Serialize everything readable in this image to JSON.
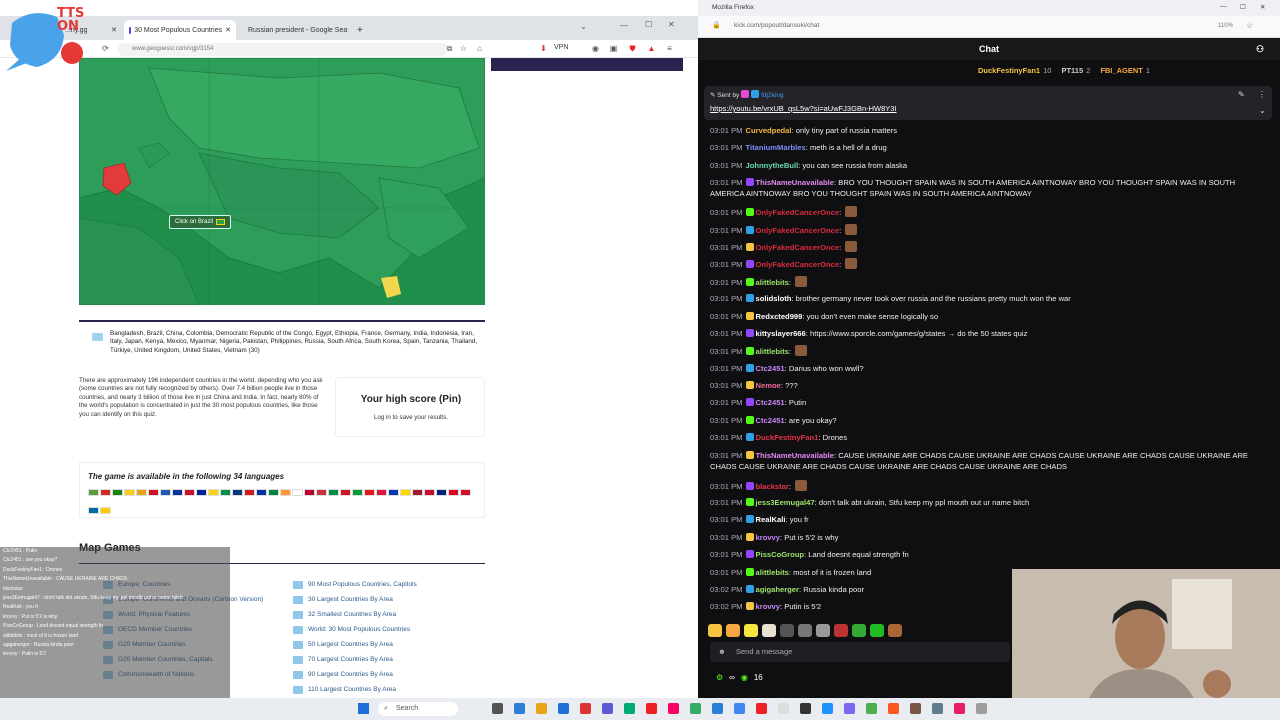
{
  "left_browser": {
    "tabs": [
      {
        "label": "...ny.gg"
      },
      {
        "label": "30 Most Populous Countries"
      },
      {
        "label": "Russian president - Google Sea"
      }
    ],
    "new_tab_symbol": "+",
    "url": "www.geoguessr.com/vgp/3154",
    "vpn_label": "VPN",
    "map_tooltip": "Click on Brazil",
    "answers_text": "Bangladesh, Brazil, China, Colombia, Democratic Republic of the Congo, Egypt, Ethiopia, France, Germany, India, Indonesia, Iran, Italy, Japan, Kenya, Mexico, Myanmar, Nigeria, Pakistan, Philippines, Russia, South Africa, South Korea, Spain, Tanzania, Thailand, Türkiye, United Kingdom, United States, Vietnam (30)",
    "description": "There are approximately 196 independent countries in the world, depending who you ask (some countries are not fully recognized by others). Over 7.4 billion people live in those countries, and nearly 3 billion of those live in just China and India. In fact, nearly 80% of the world's population is concentrated in just the 30 most populous countries, like those you can identify on this quiz.",
    "high_score_title": "Your high score (Pin)",
    "high_score_sub": "Log in to save your results.",
    "languages_title": "The game is available in the following 34 languages",
    "map_games_title": "Map Games",
    "map_games_col1": [
      "Europe: Countries",
      "Europe: Continents and Oceans (Cartoon Version)",
      "World: Physical Features",
      "OECD Member Countries",
      "G20 Member Countries",
      "G20 Member Countries, Capitals",
      "Commonwealth of Nations"
    ],
    "map_games_col2": [
      "90 Most Populous Countries, Capitols",
      "30 Largest Countries By Area",
      "32 Smallest Countries By Area",
      "World: 30 Most Populous Countries",
      "50 Largest Countries By Area",
      "70 Largest Countries By Area",
      "90 Largest Countries By Area",
      "110 Largest Countries By Area"
    ]
  },
  "tts_overlay": {
    "text": "TTS ON"
  },
  "mini_chat": [
    "Ctc2451 : Putin",
    "Ctc2451 : are you okay?",
    "DuckFestinyFan1 : Drones",
    "ThisNameUnavailable : CAUSE UKRAINE ARE CHADS",
    "blackstar",
    "jess3Eemugal47 : don't talk abt ukrain, Stfu keep my ppl mouth out ur name bitch",
    "RealKali : you fr",
    "krovvy : Put is 5'2 is why",
    "PissCoGroup : Land doesnt equal strength fn",
    "alittlebits : most of it is frozen land",
    "agigaherger : Russia kinda poor",
    "krovvy : Putin is 5'2"
  ],
  "right_browser": {
    "window_title": "Mozilla Firefox",
    "url": "kick.com/popout/dansuki/chat",
    "zoom": "110%",
    "chat_title": "Chat",
    "leaderboard": [
      {
        "name": "DuckFestinyFan1",
        "count": "10",
        "color": "#f5c542"
      },
      {
        "name": "PT115",
        "count": "2",
        "color": "#cfcfcf"
      },
      {
        "name": "FBI_AGENT",
        "count": "1",
        "color": "#f5a742"
      }
    ],
    "pinned_by_label": "Sent by",
    "pinned_by_user": "fdj2king",
    "pinned_link": "https://youtu.be/vrxUB_qsL5w?si=aUwFJ3GBn-HW8Y3I",
    "messages": [
      {
        "time": "03:01 PM",
        "user": "Curvedpedal",
        "color": "#f2b640",
        "text": "only tiny part of russia matters"
      },
      {
        "time": "03:01 PM",
        "user": "TitaniumMarbles",
        "color": "#7b8ff7",
        "text": "meth is a hell of a drug"
      },
      {
        "time": "03:01 PM",
        "user": "JohnnytheBull",
        "color": "#6bd9b0",
        "text": "you can see russia from alaska"
      },
      {
        "time": "03:01 PM",
        "user": "ThisNameUnavailable",
        "color": "#e88af5",
        "text": "BRO YOU THOUGHT SPAIN WAS IN SOUTH AMERICA AINTNOWAY BRO YOU THOUGHT SPAIN WAS IN SOUTH AMERICA AINTNOWAY BRO YOU THOUGHT SPAIN WAS IN SOUTH AMERICA AINTNOWAY"
      },
      {
        "time": "03:01 PM",
        "user": "OnlyFakedCancerOnce",
        "color": "#d92c3e",
        "text": ""
      },
      {
        "time": "03:01 PM",
        "user": "OnlyFakedCancerOnce",
        "color": "#d92c3e",
        "text": ""
      },
      {
        "time": "03:01 PM",
        "user": "OnlyFakedCancerOnce",
        "color": "#d92c3e",
        "text": ""
      },
      {
        "time": "03:01 PM",
        "user": "OnlyFakedCancerOnce",
        "color": "#d92c3e",
        "text": ""
      },
      {
        "time": "03:01 PM",
        "user": "alittlebits",
        "color": "#9be36b",
        "text": ""
      },
      {
        "time": "03:01 PM",
        "user": "solidsloth",
        "color": "#ffffff",
        "text": "brother germany never took over russia and the russians pretty much won the war"
      },
      {
        "time": "03:01 PM",
        "user": "Redxcted999",
        "color": "#ffffff",
        "text": "you don't even make sense logically so"
      },
      {
        "time": "03:01 PM",
        "user": "kittyslayer666",
        "color": "#ffffff",
        "text": "https://www.sporcle.com/games/g/states → do the 50 states quiz"
      },
      {
        "time": "03:01 PM",
        "user": "alittlebits",
        "color": "#9be36b",
        "text": ""
      },
      {
        "time": "03:01 PM",
        "user": "Ctc2451",
        "color": "#c58af7",
        "text": "Darius who won wwll?"
      },
      {
        "time": "03:01 PM",
        "user": "Nemoe",
        "color": "#f06b9b",
        "text": "???"
      },
      {
        "time": "03:01 PM",
        "user": "Ctc2451",
        "color": "#c58af7",
        "text": "Putin"
      },
      {
        "time": "03:01 PM",
        "user": "Ctc2451",
        "color": "#c58af7",
        "text": "are you okay?"
      },
      {
        "time": "03:01 PM",
        "user": "DuckFestinyFan1",
        "color": "#e6344a",
        "text": "Drones"
      },
      {
        "time": "03:01 PM",
        "user": "ThisNameUnavailable",
        "color": "#e88af5",
        "text": "CAUSE UKRAINE ARE CHADS  CAUSE UKRAINE ARE CHADS  CAUSE UKRAINE ARE CHADS  CAUSE UKRAINE ARE CHADS  CAUSE UKRAINE ARE CHADS  CAUSE UKRAINE ARE CHADS  CAUSE UKRAINE ARE CHADS"
      },
      {
        "time": "03:01 PM",
        "user": "blackstar",
        "color": "#e6344a",
        "text": ""
      },
      {
        "time": "03:01 PM",
        "user": "jess3Eemugal47",
        "color": "#9be36b",
        "text": "don't talk abt ukrain, Stfu keep my ppl mouth out ur name bitch"
      },
      {
        "time": "03:01 PM",
        "user": "RealKali",
        "color": "#ffffff",
        "text": "you fr"
      },
      {
        "time": "03:01 PM",
        "user": "krovvy",
        "color": "#c58af7",
        "text": "Put is 5'2 is why"
      },
      {
        "time": "03:01 PM",
        "user": "PissCoGroup",
        "color": "#9be36b",
        "text": "Land doesnt equal strength fn"
      },
      {
        "time": "03:01 PM",
        "user": "alittlebits",
        "color": "#9be36b",
        "text": "most of it is frozen land"
      },
      {
        "time": "03:02 PM",
        "user": "agigaherger",
        "color": "#9be36b",
        "text": "Russia kinda poor"
      },
      {
        "time": "03:02 PM",
        "user": "krovvy",
        "color": "#c58af7",
        "text": "Putin is 5'2"
      }
    ],
    "send_placeholder": "Send a message",
    "viewer_count": "16"
  },
  "taskbar": {
    "search_label": "Search"
  }
}
